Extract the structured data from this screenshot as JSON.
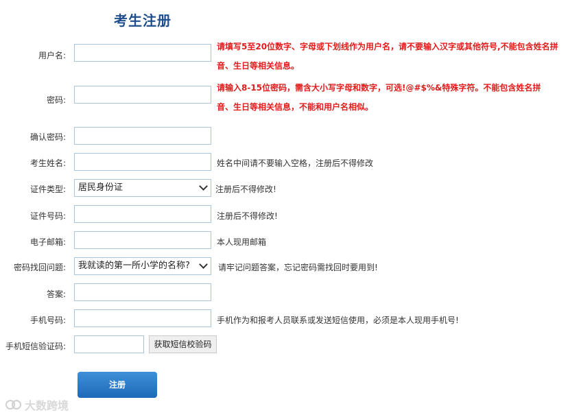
{
  "form": {
    "title": "考生注册",
    "fields": {
      "username": {
        "label": "用户名:",
        "hint_line1": "请填写5至20位数字、字母或下划线作为用户名，请不要输入汉字或其他符号,不能包含姓名拼",
        "hint_line2": "音、生日等相关信息。"
      },
      "password": {
        "label": "密码:",
        "hint_line1": "请输入8-15位密码，需含大小写字母和数字，可选!@#$%&特殊字符。不能包含姓名拼",
        "hint_line2": "音、生日等相关信息，不能和用户名相似。"
      },
      "confirm_password": {
        "label": "确认密码:"
      },
      "name": {
        "label": "考生姓名:",
        "hint": "姓名中间请不要输入空格，注册后不得修改"
      },
      "id_type": {
        "label": "证件类型:",
        "selected": "居民身份证",
        "hint": "注册后不得修改!"
      },
      "id_number": {
        "label": "证件号码:",
        "hint": "注册后不得修改!"
      },
      "email": {
        "label": "电子邮箱:",
        "hint": "本人现用邮箱"
      },
      "security_question": {
        "label": "密码找回问题:",
        "selected": "我就读的第一所小学的名称?",
        "hint": "请牢记问题答案，忘记密码需找回时要用到!"
      },
      "answer": {
        "label": "答案:"
      },
      "phone": {
        "label": "手机号码:",
        "hint": "手机作为和报考人员联系或发送短信使用，必须是本人现用手机号!"
      },
      "sms_code": {
        "label": "手机短信验证码:",
        "button_label": "获取短信校验码"
      }
    },
    "submit_label": "注册"
  },
  "watermark": {
    "text": "大数跨境"
  },
  "colors": {
    "title": "#1f4e8c",
    "hint_red": "#e21b1b",
    "input_border": "#a9c3dc",
    "button_blue": "#1e6ab8"
  }
}
